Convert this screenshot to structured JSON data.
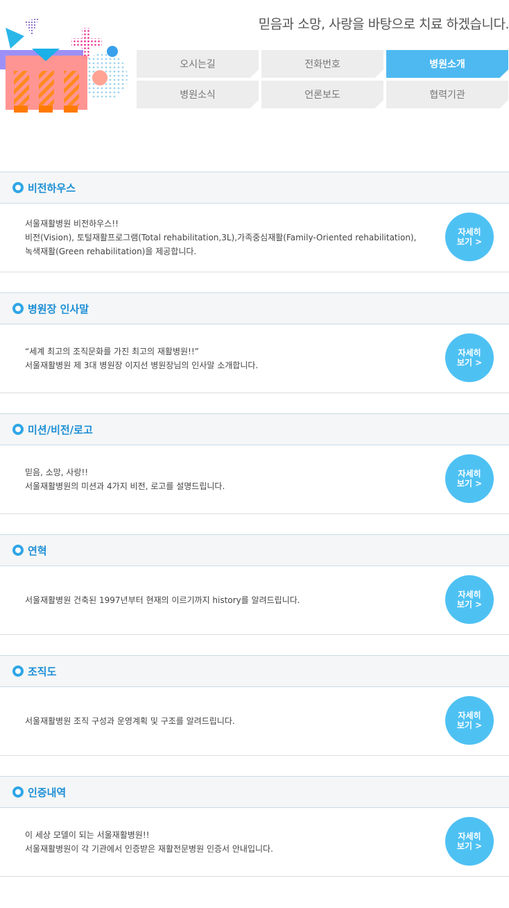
{
  "slogan": "믿음과 소망, 사랑을 바탕으로 치료 하겠습니다.",
  "nav": [
    {
      "label": "오시는길"
    },
    {
      "label": "전화번호"
    },
    {
      "label": "병원소개"
    },
    {
      "label": "병원소식"
    },
    {
      "label": "언론보도"
    },
    {
      "label": "협력기관"
    }
  ],
  "active_nav": "병원소개",
  "more_button": {
    "line1": "자세히",
    "line2": "보기 >"
  },
  "sections": [
    {
      "title": "비전하우스",
      "lines": [
        "서울재활병원 비전하우스!!",
        "비전(Vision), 토털재활프로그램(Total rehabilitation,3L),가족중심재활(Family-Oriented rehabilitation),",
        "녹색재활(Green rehabilitation)을 제공합니다."
      ]
    },
    {
      "title": "병원장 인사말",
      "lines": [
        "“세계 최고의 조직문화를 가진 최고의 재활병원!!”",
        "서울재활병원 제 3대 병원장 이지선 병원장님의 인사말 소개합니다."
      ]
    },
    {
      "title": "미션/비전/로고",
      "lines": [
        "믿음, 소망, 사랑!!",
        "서울재활병원의 미션과 4가지 비전, 로고를 설명드립니다."
      ]
    },
    {
      "title": "연혁",
      "lines": [
        "서울재활병원 건축된 1997년부터 현재의 이르기까지 history를 알려드립니다."
      ]
    },
    {
      "title": "조직도",
      "lines": [
        "서울재활병원 조직 구성과 운영계획 및 구조를 알려드립니다."
      ]
    },
    {
      "title": "인증내역",
      "lines": [
        "이 세상 모델이 되는 서울재활병원!!",
        "서울재활병원이 각 기관에서 인증받은 재활전문병원 인증서 안내입니다."
      ]
    }
  ]
}
